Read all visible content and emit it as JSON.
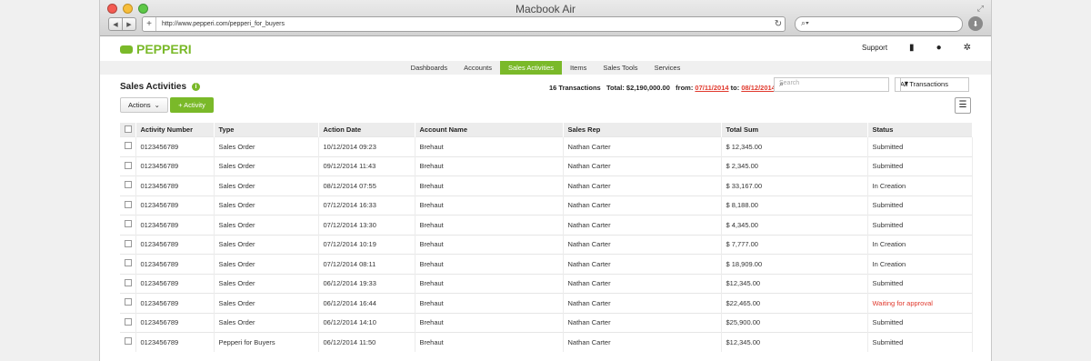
{
  "browser": {
    "window_title": "Macbook Air",
    "url": "http://www.pepperi.com/pepperi_for_buyers"
  },
  "app": {
    "logo_text": "PEPPERI",
    "support_label": "Support",
    "brand_color": "#7ab929",
    "menu": [
      "Dashboards",
      "Accounts",
      "Sales Activities",
      "Items",
      "Sales Tools",
      "Services"
    ],
    "active_menu": "Sales Activities"
  },
  "toolbar": {
    "title": "Sales Activities",
    "transactions": "16 Transactions",
    "total_label": "Total:",
    "total_value": "$2,190,000.00",
    "from_label": "from:",
    "from_date": "07/11/2014",
    "to_label": "to:",
    "to_date": "08/12/2014",
    "search_placeholder": "Search",
    "filter_value": "All Transactions",
    "actions_label": "Actions",
    "add_label": "+ Activity"
  },
  "table": {
    "headers": [
      "Activity Number",
      "Type",
      "Action Date",
      "Account Name",
      "Sales Rep",
      "Total Sum",
      "Status"
    ],
    "rows": [
      [
        "0123456789",
        "Sales Order",
        "10/12/2014  09:23",
        "Brehaut",
        "Nathan Carter",
        "$ 12,345.00",
        "Submitted"
      ],
      [
        "0123456789",
        "Sales Order",
        "09/12/2014  11:43",
        "Brehaut",
        "Nathan Carter",
        "$ 2,345.00",
        "Submitted"
      ],
      [
        "0123456789",
        "Sales Order",
        "08/12/2014  07:55",
        "Brehaut",
        "Nathan Carter",
        "$ 33,167.00",
        "In Creation"
      ],
      [
        "0123456789",
        "Sales Order",
        "07/12/2014  16:33",
        "Brehaut",
        "Nathan Carter",
        "$ 8,188.00",
        "Submitted"
      ],
      [
        "0123456789",
        "Sales Order",
        "07/12/2014  13:30",
        "Brehaut",
        "Nathan Carter",
        "$ 4,345.00",
        "Submitted"
      ],
      [
        "0123456789",
        "Sales Order",
        "07/12/2014  10:19",
        "Brehaut",
        "Nathan Carter",
        "$ 7,777.00",
        "In Creation"
      ],
      [
        "0123456789",
        "Sales Order",
        "07/12/2014  08:11",
        "Brehaut",
        "Nathan Carter",
        "$ 18,909.00",
        "In Creation"
      ],
      [
        "0123456789",
        "Sales Order",
        "06/12/2014  19:33",
        "Brehaut",
        "Nathan Carter",
        "$12,345.00",
        "Submitted"
      ],
      [
        "0123456789",
        "Sales Order",
        "06/12/2014  16:44",
        "Brehaut",
        "Nathan Carter",
        "$22,465.00",
        "Waiting for approval"
      ],
      [
        "0123456789",
        "Sales Order",
        "06/12/2014  14:10",
        "Brehaut",
        "Nathan Carter",
        "$25,900.00",
        "Submitted"
      ],
      [
        "0123456789",
        "Pepperi for Buyers",
        "06/12/2014  11:50",
        "Brehaut",
        "Nathan Carter",
        "$12,345.00",
        "Submitted"
      ]
    ]
  }
}
